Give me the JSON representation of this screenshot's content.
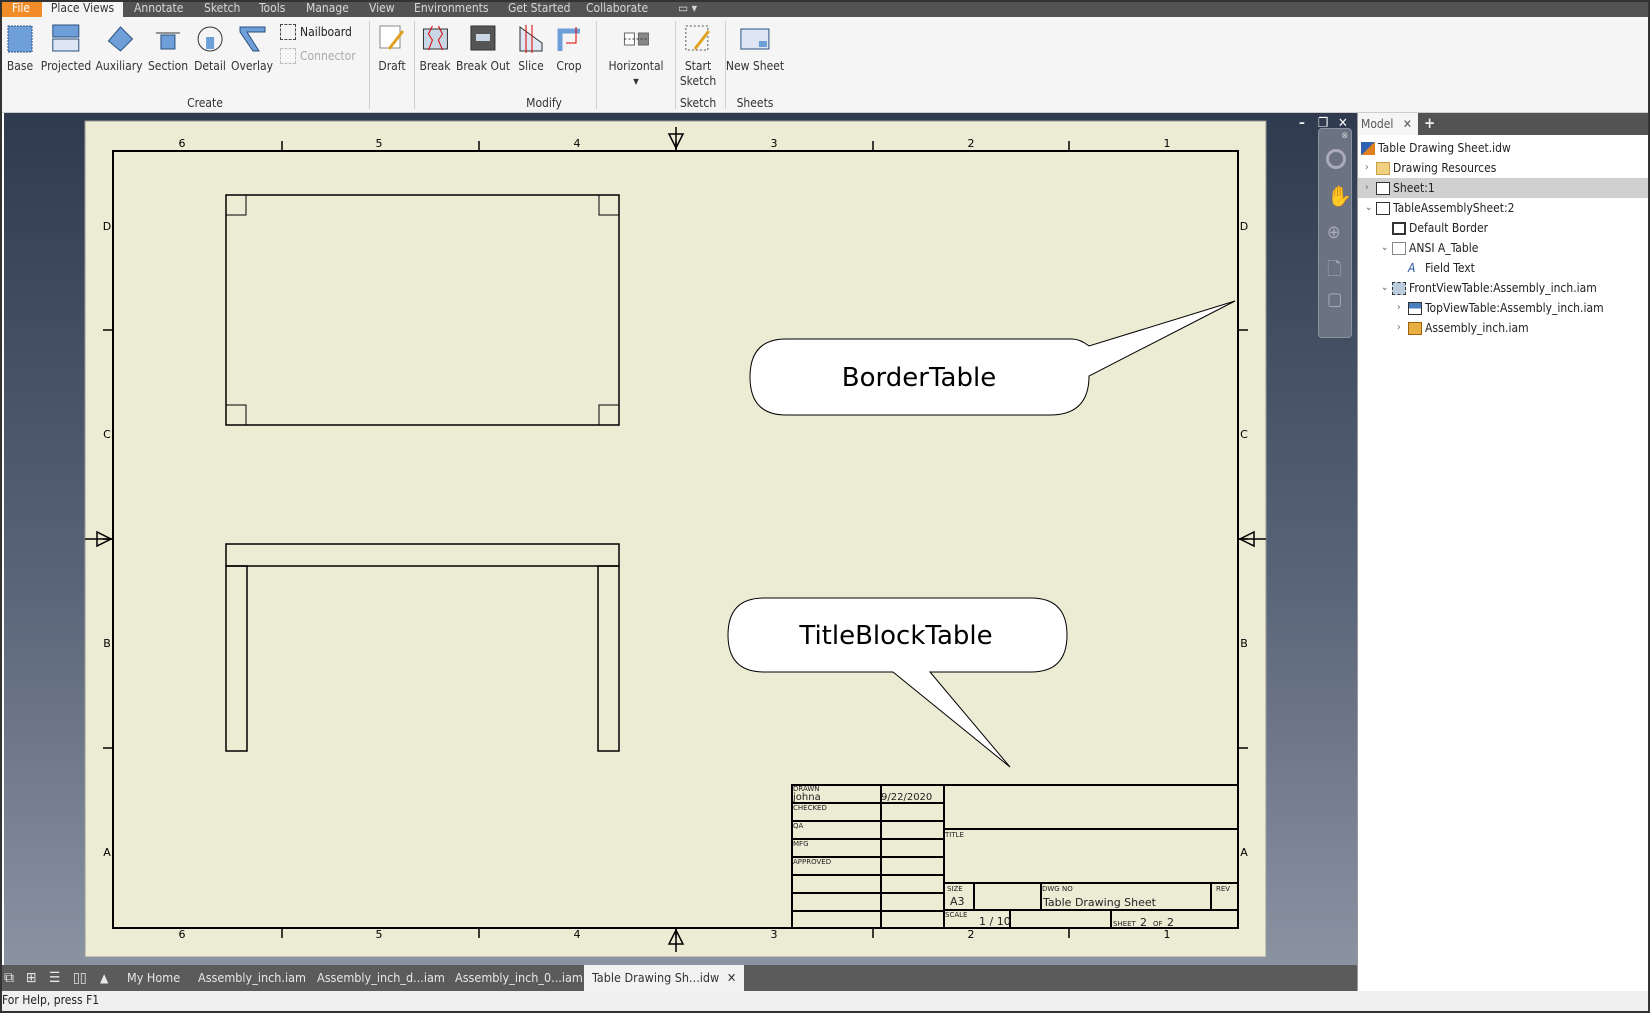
{
  "ribbon": {
    "tabs": [
      "File",
      "Place Views",
      "Annotate",
      "Sketch",
      "Tools",
      "Manage",
      "View",
      "Environments",
      "Get Started",
      "Collaborate"
    ],
    "active_tab": "Place Views",
    "buttons": {
      "base": "Base",
      "projected": "Projected",
      "auxiliary": "Auxiliary",
      "section": "Section",
      "detail": "Detail",
      "overlay": "Overlay",
      "nailboard": "Nailboard",
      "connector": "Connector",
      "draft": "Draft",
      "break": "Break",
      "break_out": "Break Out",
      "slice": "Slice",
      "crop": "Crop",
      "horizontal": "Horizontal",
      "start_sketch_1": "Start",
      "start_sketch_2": "Sketch",
      "new_sheet": "New Sheet"
    },
    "groups": {
      "create": "Create",
      "modify": "Modify",
      "sketch": "Sketch",
      "sheets": "Sheets"
    }
  },
  "sheet": {
    "zones_cols": [
      "6",
      "5",
      "4",
      "3",
      "2",
      "1"
    ],
    "zones_rows": [
      "D",
      "C",
      "B",
      "A"
    ],
    "callouts": {
      "border": "BorderTable",
      "titleblock": "TitleBlockTable"
    },
    "title_block": {
      "drawn_label": "DRAWN",
      "drawn_by": "johna",
      "drawn_date": "9/22/2020",
      "checked_label": "CHECKED",
      "qa_label": "QA",
      "mfg_label": "MFG",
      "approved_label": "APPROVED",
      "title_label": "TITLE",
      "size_label": "SIZE",
      "size": "A3",
      "dwg_no_label": "DWG NO",
      "dwg_no": "Table Drawing Sheet",
      "rev_label": "REV",
      "scale_label": "SCALE",
      "scale": "1 / 10",
      "sheet_label": "SHEET",
      "sheet_num": "2",
      "of_label": "OF",
      "sheet_total": "2"
    },
    "background": "#ecebd4"
  },
  "browser": {
    "tab": "Model",
    "add": "+",
    "items": [
      {
        "label": "Table Drawing Sheet.idw",
        "icon": "drawing-file-icon"
      },
      {
        "label": "Drawing Resources",
        "icon": "folder-icon"
      },
      {
        "label": "Sheet:1",
        "icon": "sheet-icon",
        "selected": true
      },
      {
        "label": "TableAssemblySheet:2",
        "icon": "sheet-icon"
      },
      {
        "label": "Default Border",
        "icon": "border-icon"
      },
      {
        "label": "ANSI A_Table",
        "icon": "title-block-icon"
      },
      {
        "label": "Field Text",
        "icon": "field-text-icon"
      },
      {
        "label": "FrontViewTable:Assembly_inch.iam",
        "icon": "base-view-icon"
      },
      {
        "label": "TopViewTable:Assembly_inch.iam",
        "icon": "projected-view-icon"
      },
      {
        "label": "Assembly_inch.iam",
        "icon": "assembly-icon"
      }
    ]
  },
  "doc_tabs": [
    "My Home",
    "Assembly_inch.iam",
    "Assembly_inch_d...iam",
    "Assembly_inch_0...iam",
    "Table Drawing Sh...idw"
  ],
  "active_doc": "Table Drawing Sh...idw",
  "status": "For Help, press F1"
}
